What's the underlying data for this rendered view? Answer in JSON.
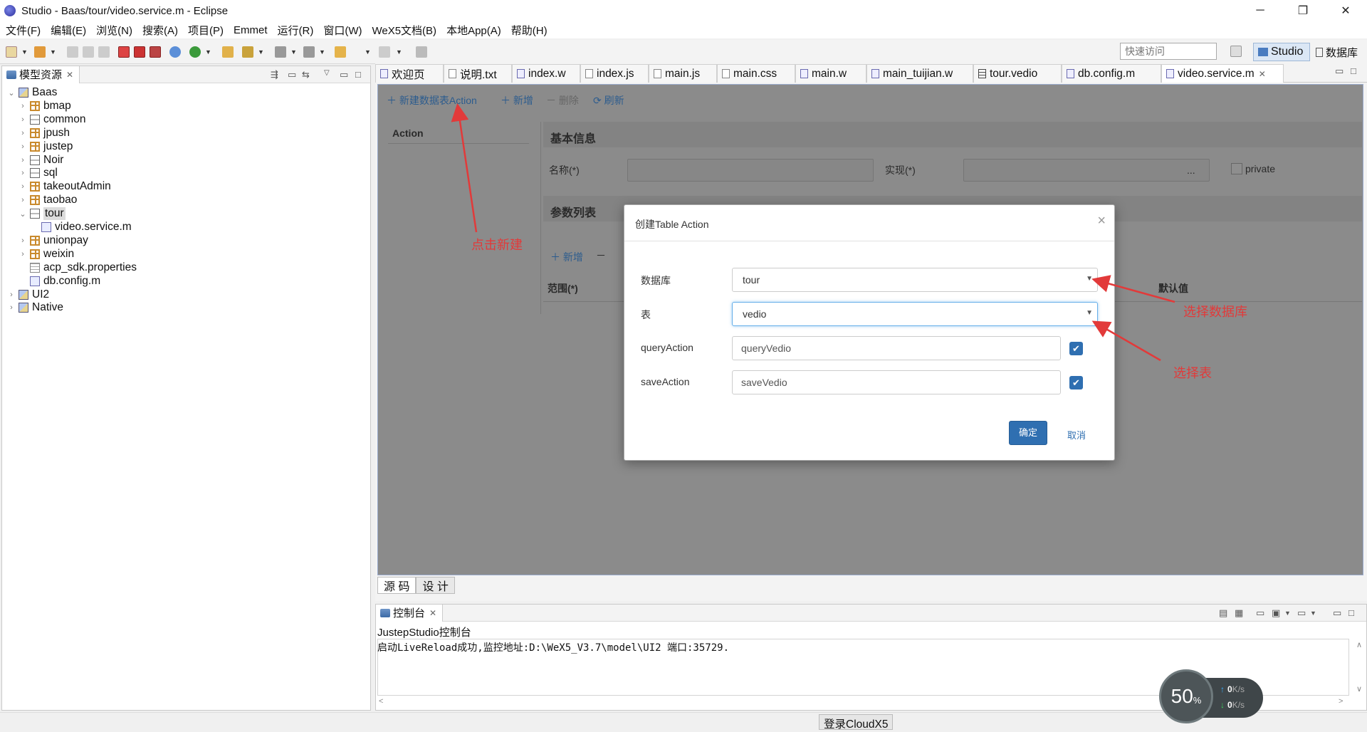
{
  "window": {
    "title": "Studio - Baas/tour/video.service.m - Eclipse"
  },
  "menu": [
    "文件(F)",
    "编辑(E)",
    "浏览(N)",
    "搜索(A)",
    "项目(P)",
    "Emmet",
    "运行(R)",
    "窗口(W)",
    "WeX5文档(B)",
    "本地App(A)",
    "帮助(H)"
  ],
  "toolbar": {
    "quick_access_placeholder": "快速访问",
    "perspective_studio": "Studio",
    "perspective_db": "数据库"
  },
  "model_panel": {
    "tab_label": "模型资源",
    "tree": [
      {
        "label": "Baas",
        "depth": 0,
        "expanded": true,
        "icon": "project-icon"
      },
      {
        "label": "bmap",
        "depth": 1,
        "icon": "package-icon"
      },
      {
        "label": "common",
        "depth": 1,
        "icon": "db-icon"
      },
      {
        "label": "jpush",
        "depth": 1,
        "icon": "package-icon"
      },
      {
        "label": "justep",
        "depth": 1,
        "icon": "package-icon"
      },
      {
        "label": "Noir",
        "depth": 1,
        "icon": "db-icon"
      },
      {
        "label": "sql",
        "depth": 1,
        "icon": "db-icon"
      },
      {
        "label": "takeoutAdmin",
        "depth": 1,
        "icon": "package-icon"
      },
      {
        "label": "taobao",
        "depth": 1,
        "icon": "package-icon"
      },
      {
        "label": "tour",
        "depth": 1,
        "expanded": true,
        "selected": true,
        "icon": "db-icon"
      },
      {
        "label": "video.service.m",
        "depth": 2,
        "icon": "file-icon"
      },
      {
        "label": "unionpay",
        "depth": 1,
        "icon": "package-icon"
      },
      {
        "label": "weixin",
        "depth": 1,
        "icon": "package-icon"
      },
      {
        "label": "acp_sdk.properties",
        "depth": 1,
        "icon": "properties-icon"
      },
      {
        "label": "db.config.m",
        "depth": 1,
        "icon": "file-icon"
      },
      {
        "label": "UI2",
        "depth": 0,
        "icon": "project-icon"
      },
      {
        "label": "Native",
        "depth": 0,
        "icon": "project-icon"
      }
    ]
  },
  "editor_tabs": [
    "欢迎页",
    "说明.txt",
    "index.w",
    "index.js",
    "main.js",
    "main.css",
    "main.w",
    "main_tuijian.w",
    "tour.vedio",
    "db.config.m",
    "video.service.m"
  ],
  "design": {
    "toolbar": {
      "new_db_action": "新建数据表Action",
      "add": "新增",
      "delete": "删除",
      "refresh": "刷新"
    },
    "action_header": "Action",
    "basic_info_title": "基本信息",
    "name_label": "名称(*)",
    "impl_label": "实现(*)",
    "impl_btn": "...",
    "private_label": "private",
    "params_title": "参数列表",
    "params_add": "新增",
    "scope_label": "范围(*)",
    "default_label": "默认值",
    "bottom_tabs": [
      "源 码",
      "设 计"
    ]
  },
  "dialog": {
    "title": "创建Table Action",
    "close": "×",
    "db_label": "数据库",
    "db_value": "tour",
    "table_label": "表",
    "table_value": "vedio",
    "query_label": "queryAction",
    "query_value": "queryVedio",
    "save_label": "saveAction",
    "save_value": "saveVedio",
    "ok": "确定",
    "cancel": "取消"
  },
  "annotations": {
    "click_new": "点击新建",
    "select_db": "选择数据库",
    "select_table": "选择表"
  },
  "console": {
    "tab_label": "控制台",
    "title": "JustepStudio控制台",
    "log": "启动LiveReload成功,监控地址:D:\\WeX5_V3.7\\model\\UI2 端口:35729."
  },
  "statusbar": {
    "login": "登录CloudX5"
  },
  "speed_widget": {
    "percent": "50",
    "percent_unit": "%",
    "up": "0",
    "down": "0",
    "unit": "K/s"
  }
}
